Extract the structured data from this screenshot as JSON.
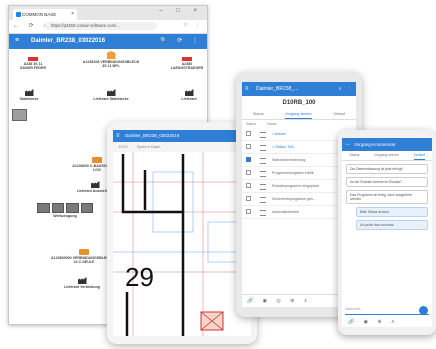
{
  "browser": {
    "tab_title": "COMMON BASE",
    "window_controls": "– □ ×",
    "nav_icons": "← ⟳ ⌂",
    "url": "https://p3450.corsair-software.com/...",
    "browser_icons": "☆ ⋮",
    "app_title": "Daimler_BR238_03022016",
    "app_actions": "🔍 ⟳ ⋮"
  },
  "diagram": {
    "nodes": [
      {
        "label": "A238 3S 11 SANDR.FEDER"
      },
      {
        "label": "A1238108 VERBINDUNGSBLECH 3S 11 BPL"
      },
      {
        "label": "A2380 LAENGSTRAEGER"
      },
      {
        "label": "Stahlwerke"
      },
      {
        "label": "Lieferant Stahlwerke"
      },
      {
        "label": "Lieferant"
      },
      {
        "label": "A1238000 C-BAUSCHE 2S 22 LOG"
      },
      {
        "label": "Lieferant Ausstellung"
      },
      {
        "label": "Werkzeugung"
      },
      {
        "label": "A123800000 VERBINDUNGSBLECH 3S 22 C-SEULE"
      },
      {
        "label": "Lieferant Verbindung"
      }
    ]
  },
  "tablet": {
    "title": "Daimler_BR238_03022016",
    "sub_left": "DGS",
    "sub_right": "System Datei",
    "plan_number": "29"
  },
  "ipad": {
    "title": "Daimler_BR238_...",
    "dialog_title": "D10RB_100",
    "tabs": [
      "Status",
      "Vorgang setzen",
      "Verlauf"
    ],
    "col_headers": [
      "Status",
      "Name"
    ],
    "rows": [
      {
        "text": "> Aktiver",
        "checked": false,
        "blue": true
      },
      {
        "text": "> Station 10A",
        "checked": false,
        "blue": true
      },
      {
        "text": "Stationsbezeichnung",
        "checked": true,
        "blue": false
      },
      {
        "text": "Programmvorgaben erfüllt",
        "checked": false,
        "blue": false
      },
      {
        "text": "Roboterprogramm eingeplant",
        "checked": false,
        "blue": false
      },
      {
        "text": "Sicherheitsprogramm ges...",
        "checked": false,
        "blue": false
      },
      {
        "text": "Automatikbetrieb",
        "checked": false,
        "blue": false
      }
    ],
    "bottom_icons": "🔗 ◉ ◎ ⊕ ⋏"
  },
  "phone": {
    "title": "Vorgang-Kommentar",
    "tabs": [
      "Status",
      "Vorgang setzen",
      "Verlauf"
    ],
    "messages": [
      {
        "text": "Die Datenerfassung ist jetzt erfolgt!",
        "me": false
      },
      {
        "text": "Ist der Roboter bereits im Einsatz?",
        "me": false
      },
      {
        "text": "Das Programm ist fertig, kann ausgeführt werden.",
        "me": false
      },
      {
        "text": "Bitte Status ändern.",
        "me": true
      },
      {
        "text": "Ich prüfe das nochmal.",
        "me": true
      }
    ],
    "compose_placeholder": "Nachricht...",
    "bottom_icons": "🔗 ◉ ⊕ ⋏"
  },
  "colors": {
    "primary": "#2f7fd6",
    "accent": "#e8902a",
    "alert": "#dd3333"
  }
}
